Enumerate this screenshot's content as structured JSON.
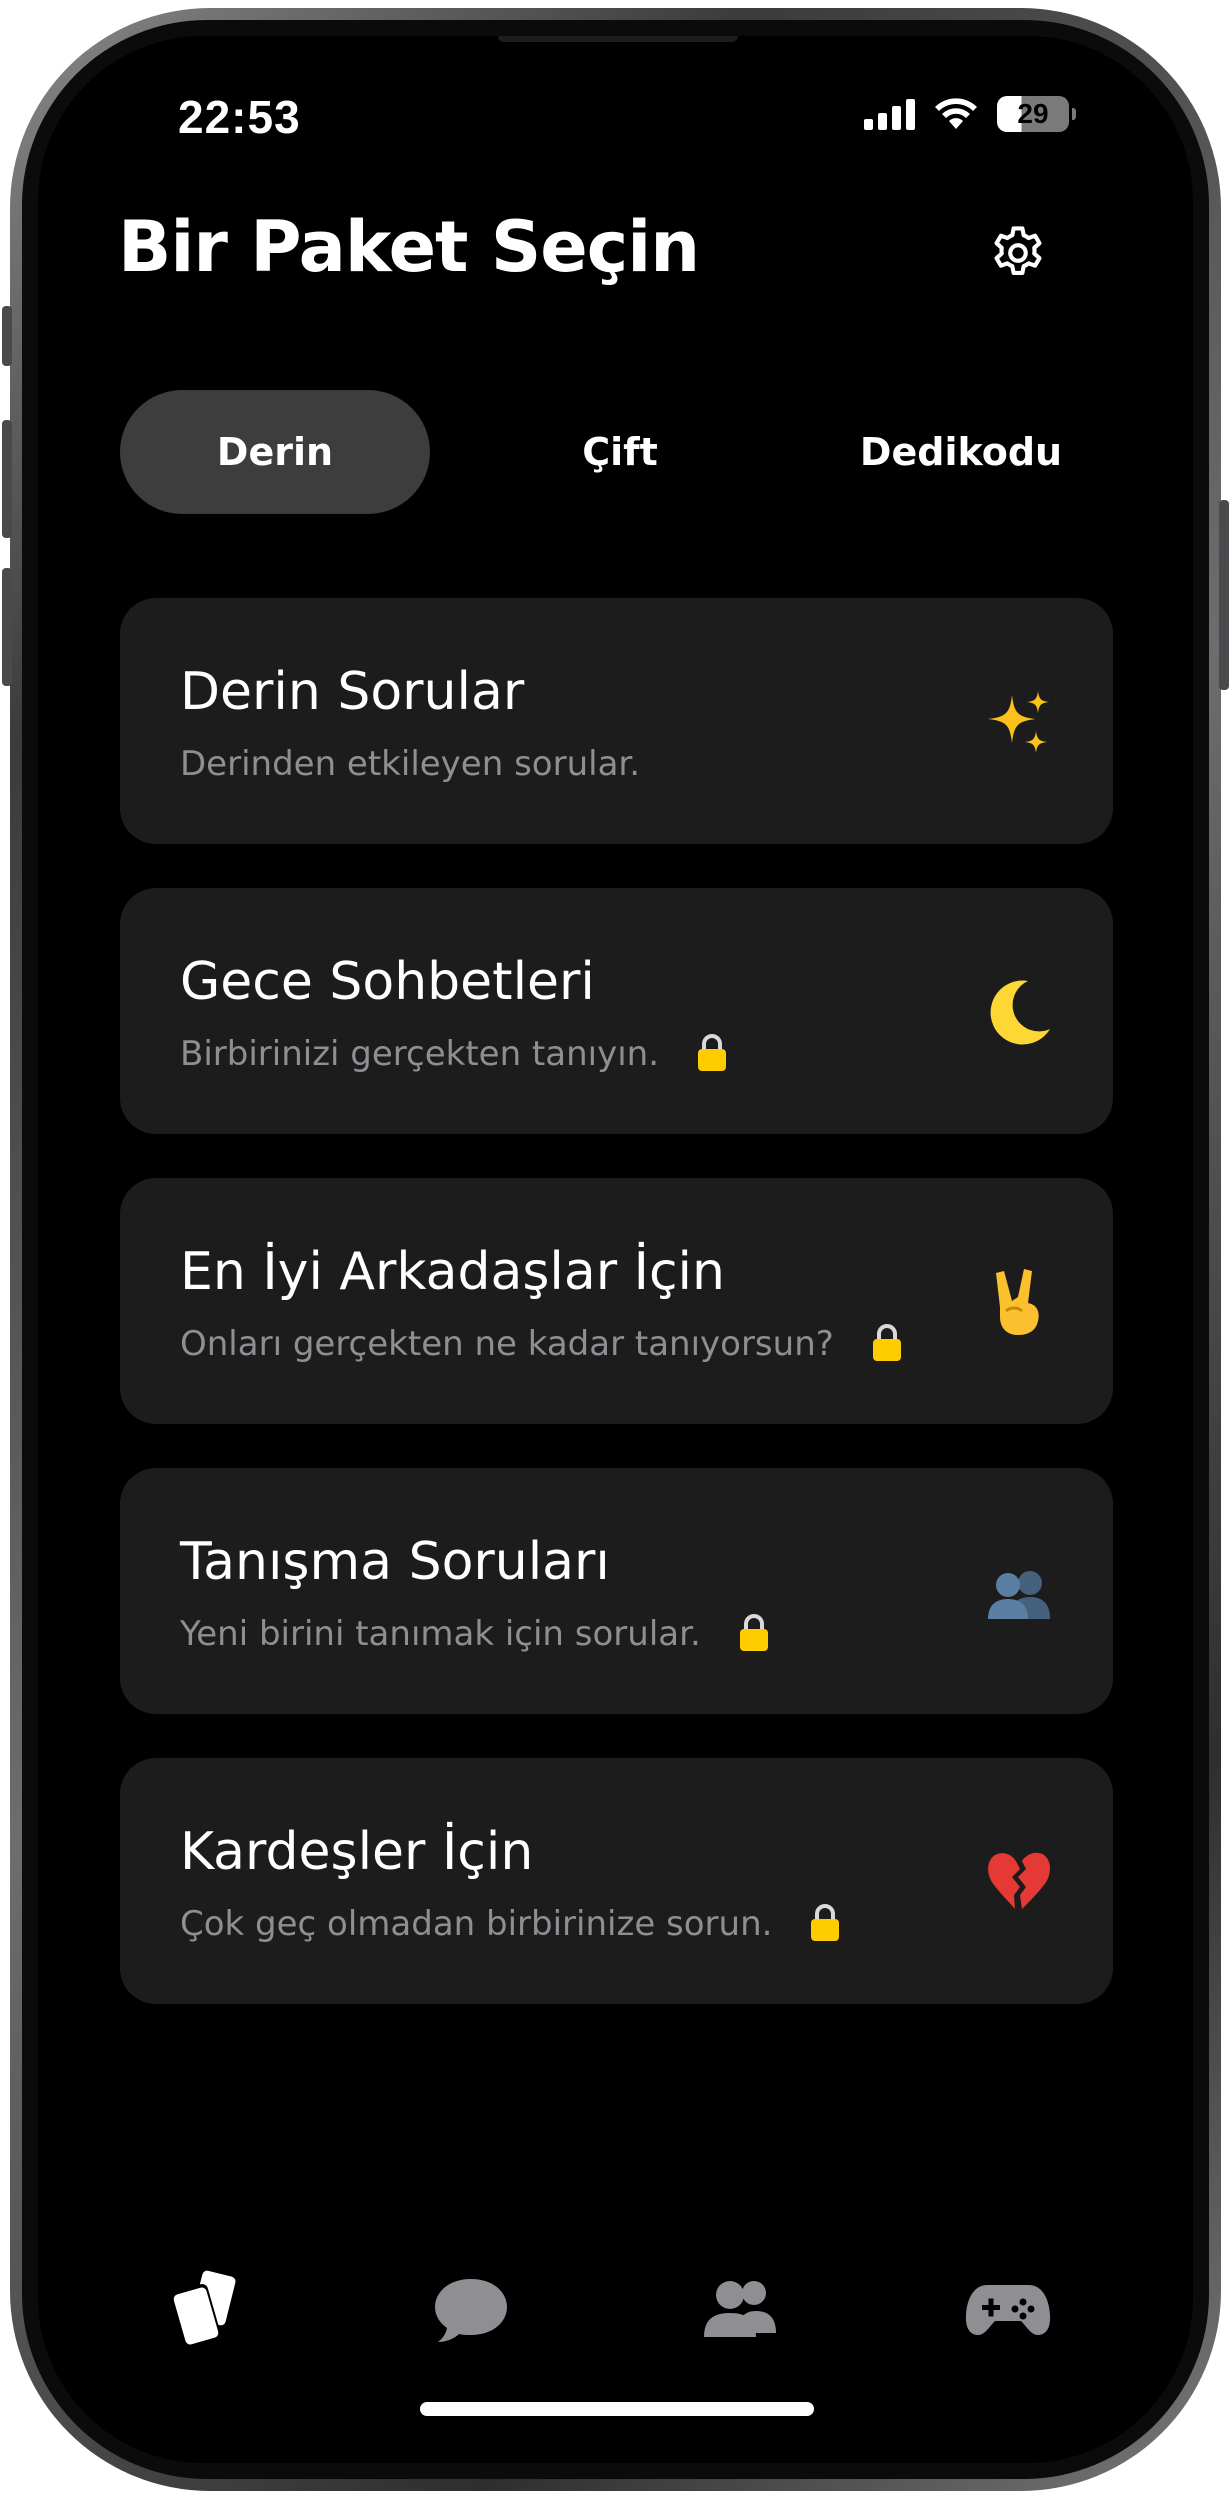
{
  "status_bar": {
    "time": "22:53",
    "battery": "29"
  },
  "header": {
    "title": "Bir Paket Seçin",
    "settings_icon": "gear-icon"
  },
  "tabs": [
    {
      "label": "Derin",
      "active": true
    },
    {
      "label": "Çift",
      "active": false
    },
    {
      "label": "Dedikodu",
      "active": false
    }
  ],
  "packs": [
    {
      "title": "Derin Sorular",
      "subtitle": "Derinden etkileyen sorular.",
      "locked": false,
      "icon": "sparkles-icon"
    },
    {
      "title": "Gece Sohbetleri",
      "subtitle": "Birbirinizi gerçekten tanıyın.",
      "locked": true,
      "icon": "crescent-moon-icon"
    },
    {
      "title": "En İyi Arkadaşlar İçin",
      "subtitle": "Onları gerçekten ne kadar tanıyorsun?",
      "locked": true,
      "icon": "victory-hand-icon"
    },
    {
      "title": "Tanışma Soruları",
      "subtitle": "Yeni birini tanımak için sorular.",
      "locked": true,
      "icon": "two-people-icon"
    },
    {
      "title": "Kardeşler İçin",
      "subtitle": "Çok geç olmadan birbirinize sorun.",
      "locked": true,
      "icon": "broken-heart-icon"
    }
  ],
  "bottom_nav": [
    {
      "icon": "cards-icon",
      "active": true
    },
    {
      "icon": "chat-bubble-icon",
      "active": false
    },
    {
      "icon": "users-icon",
      "active": false
    },
    {
      "icon": "gamepad-icon",
      "active": false
    }
  ],
  "colors": {
    "background": "#000000",
    "card": "#1c1c1d",
    "active_tab": "#3d3d3d",
    "subtitle": "#8e8e93",
    "lock": "#ffcc00",
    "inactive_nav": "#8e8e93"
  }
}
